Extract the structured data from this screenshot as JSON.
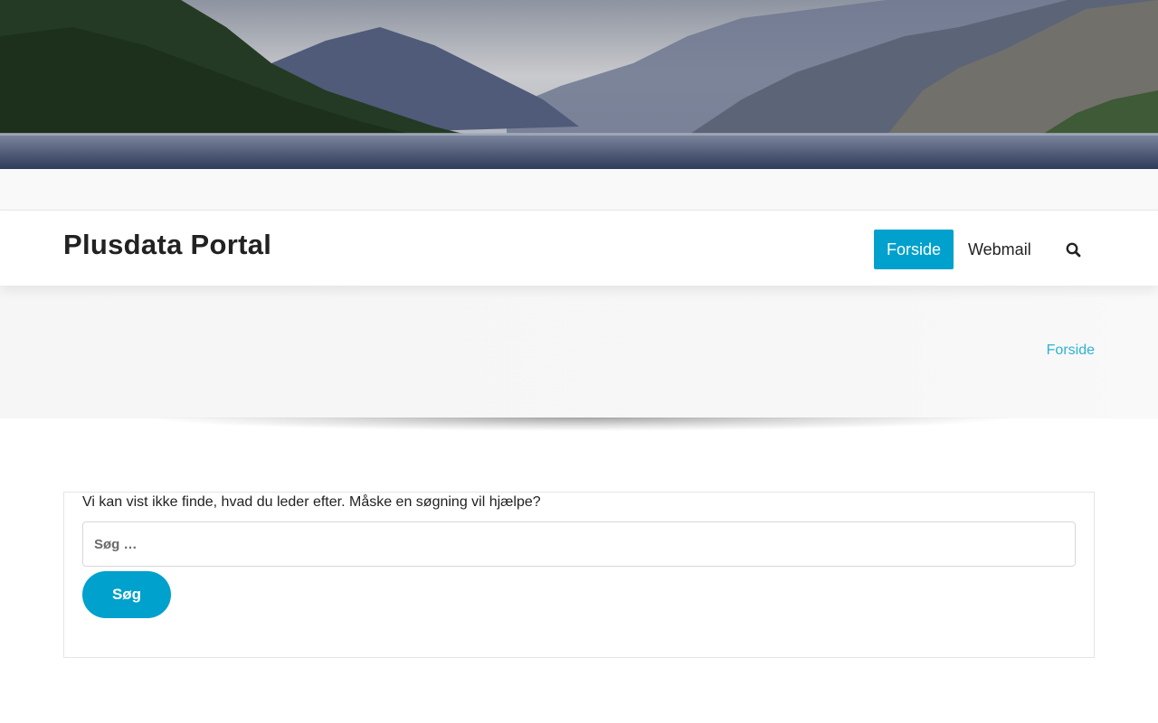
{
  "header": {
    "banner_alt": "Fjord landscape header image"
  },
  "site": {
    "title": "Plusdata Portal"
  },
  "nav": {
    "items": [
      {
        "label": "Forside",
        "active": true
      },
      {
        "label": "Webmail",
        "active": false
      }
    ],
    "search_icon": "search-icon"
  },
  "breadcrumb": {
    "current": "Forside"
  },
  "content": {
    "notice": "Vi kan vist ikke finde, hvad du leder efter. Måske en søgning vil hjælpe?",
    "search": {
      "placeholder": "Søg …",
      "value": "",
      "button_label": "Søg"
    }
  },
  "colors": {
    "accent": "#00a1cc",
    "breadcrumb_link": "#2bb3d4",
    "text": "#222222"
  }
}
